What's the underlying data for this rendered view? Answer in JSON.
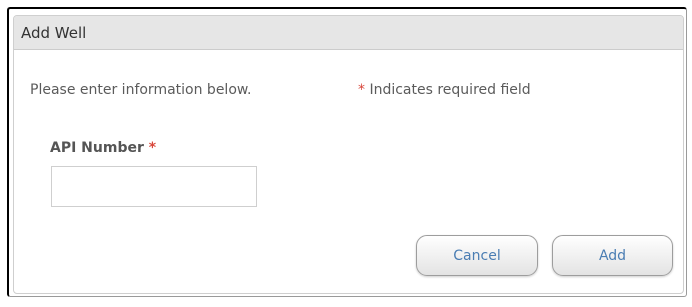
{
  "dialog": {
    "title": "Add Well"
  },
  "form": {
    "intro": "Please enter information below.",
    "required_marker": "*",
    "required_note": "Indicates required field",
    "api_number": {
      "label": "API Number",
      "value": "",
      "placeholder": ""
    }
  },
  "buttons": {
    "cancel": "Cancel",
    "add": "Add"
  },
  "colors": {
    "required_star": "#d8473b",
    "button_text": "#4a7db3",
    "titlebar_bg": "#e6e6e6"
  }
}
